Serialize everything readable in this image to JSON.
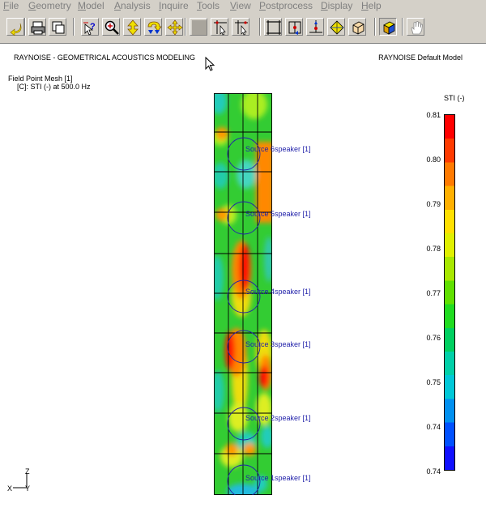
{
  "menu": [
    {
      "label": "File",
      "u": "F"
    },
    {
      "label": "Geometry",
      "u": "G"
    },
    {
      "label": "Model",
      "u": "M"
    },
    {
      "label": "Analysis",
      "u": "A"
    },
    {
      "label": "Inquire",
      "u": "I"
    },
    {
      "label": "Tools",
      "u": "T"
    },
    {
      "label": "View",
      "u": "V"
    },
    {
      "label": "Postprocess",
      "u": "P"
    },
    {
      "label": "Display",
      "u": "D"
    },
    {
      "label": "Help",
      "u": "H"
    }
  ],
  "toolbar": [
    {
      "name": "undo-button",
      "icon": "undo-arrow-icon"
    },
    {
      "name": "print-button",
      "icon": "printer-icon"
    },
    {
      "name": "copy-window-button",
      "icon": "copy-window-icon"
    },
    {
      "name": "query-button",
      "icon": "query-cursor-icon"
    },
    {
      "name": "zoom-button",
      "icon": "magnifier-icon"
    },
    {
      "name": "pan-vertical-button",
      "icon": "vertical-arrows-icon"
    },
    {
      "name": "rotate-button",
      "icon": "rotate-arrow-icon"
    },
    {
      "name": "pan-button",
      "icon": "four-way-arrows-icon"
    },
    {
      "name": "blank-button",
      "icon": "blank-square-icon"
    },
    {
      "name": "pick-button",
      "icon": "crosshair-pick-icon"
    },
    {
      "name": "pick-remove-button",
      "icon": "crosshair-remove-icon"
    },
    {
      "name": "fit-view-button",
      "icon": "frame-fit-icon"
    },
    {
      "name": "pick-node-button",
      "icon": "node-pick-icon"
    },
    {
      "name": "pick-element-button",
      "icon": "element-pick-icon"
    },
    {
      "name": "pick-vertex-button",
      "icon": "vertex-pick-icon"
    },
    {
      "name": "wireframe-box-button",
      "icon": "wire-box-icon"
    },
    {
      "name": "shaded-box-button",
      "icon": "shaded-box-icon"
    },
    {
      "name": "hand-button",
      "icon": "hand-icon"
    }
  ],
  "header": {
    "title": "RAYNOISE - GEOMETRICAL ACOUSTICS MODELING",
    "model": "RAYNOISE Default Model"
  },
  "info": {
    "mesh": "Field Point Mesh [1]",
    "result": "[C]: STI (-) at 500.0 Hz"
  },
  "sources": [
    {
      "label": "Source 6speaker [1]"
    },
    {
      "label": "Source 5speaker [1]"
    },
    {
      "label": "Source 4speaker [1]"
    },
    {
      "label": "Source 3speaker [1]"
    },
    {
      "label": "Source 2speaker [1]"
    },
    {
      "label": "Source 1speaker [1]"
    }
  ],
  "legend": {
    "title": "STI (-)",
    "labels": [
      "0.81",
      "0.80",
      "0.79",
      "0.78",
      "0.77",
      "0.76",
      "0.75",
      "0.74",
      "0.74"
    ],
    "colors": [
      "#ff0000",
      "#ff3a00",
      "#ff7a00",
      "#ffb000",
      "#ffe000",
      "#e0f000",
      "#a8e800",
      "#60e000",
      "#20dc20",
      "#00d060",
      "#00d0a8",
      "#00c8d8",
      "#0090f0",
      "#0050ff",
      "#1010ff"
    ]
  },
  "axes": {
    "z": "Z",
    "x": "X",
    "y": "Y"
  }
}
